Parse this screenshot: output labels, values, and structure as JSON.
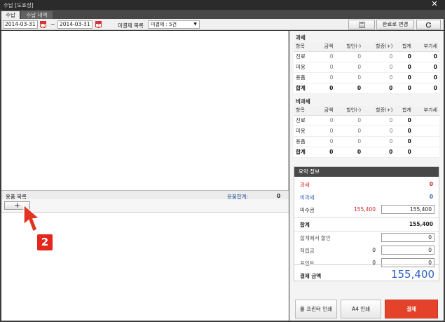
{
  "window": {
    "title": "수납 [도효성]",
    "close_label": "✕"
  },
  "tabs": [
    {
      "label": "수납"
    },
    {
      "label": "수납 내역"
    }
  ],
  "toolbar": {
    "start_date": "2014-03-31",
    "end_date": "2014-03-31",
    "range_separator": "~",
    "unpaid_label": "미결제 목록",
    "unpaid_selected": "미결제 : 5건",
    "save_icon": "floppy-icon",
    "complete_label": "완료로 변경",
    "refresh_icon": "refresh-icon"
  },
  "products": {
    "header": "용품 목록",
    "sum_label": "용품합계:",
    "sum_value": "0",
    "add_label": "+"
  },
  "annotation": {
    "badge": "2"
  },
  "taxable": {
    "title": "과세",
    "columns": [
      "항목",
      "금액",
      "할인(-)",
      "할증(+)",
      "합계",
      "부가세"
    ],
    "rows": [
      [
        "진료",
        "0",
        "0",
        "0",
        "0",
        "0"
      ],
      [
        "미용",
        "0",
        "0",
        "0",
        "0",
        "0"
      ],
      [
        "용품",
        "0",
        "0",
        "0",
        "0",
        "0"
      ],
      [
        "합계",
        "0",
        "0",
        "0",
        "0",
        "0"
      ]
    ]
  },
  "nontaxable": {
    "title": "비과세",
    "columns": [
      "항목",
      "금액",
      "할인(-)",
      "할증(+)",
      "합계",
      "부가세"
    ],
    "rows": [
      [
        "진료",
        "0",
        "0",
        "0",
        "0",
        ""
      ],
      [
        "미용",
        "0",
        "0",
        "0",
        "0",
        ""
      ],
      [
        "용품",
        "0",
        "0",
        "0",
        "0",
        ""
      ],
      [
        "합계",
        "0",
        "0",
        "0",
        "0",
        ""
      ]
    ]
  },
  "summary": {
    "title": "요약 정보",
    "taxable_label": "과세",
    "taxable_value": "0",
    "nontaxable_label": "비과세",
    "nontaxable_value": "0",
    "receivable_label": "미수금",
    "receivable_value": "155,400",
    "receivable_input": "155,400",
    "total_label": "합계",
    "total_value": "155,400",
    "discount_label": "합계에서 할인",
    "discount_input": "0",
    "points_label": "적립금",
    "points_value": "0",
    "points_input": "0",
    "point_label": "포인트",
    "point_value": "0",
    "point_input": "0",
    "pay_amount_label": "결제 금액",
    "pay_amount_value": "155,400"
  },
  "buttons": {
    "roll_print": "롤 프린터 인쇄",
    "a4_print": "A4 인쇄",
    "pay": "결제"
  },
  "colors": {
    "accent_red": "#e4422b",
    "blue": "#2d5fc4",
    "taxable_red": "#d32020"
  }
}
